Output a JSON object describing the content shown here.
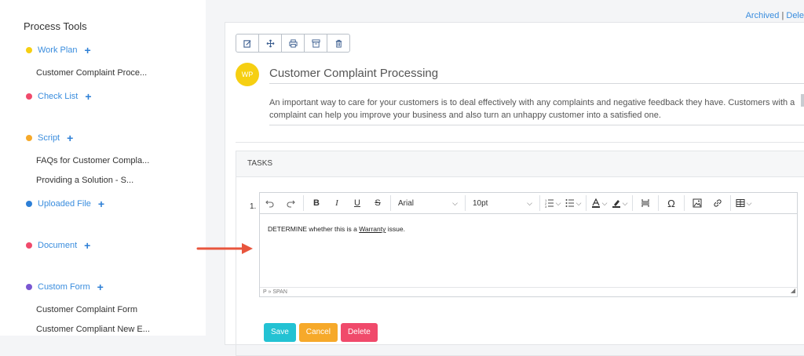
{
  "sidebar": {
    "title": "Process Tools",
    "sections": [
      {
        "label": "Work Plan",
        "color": "#f6cf12",
        "items": [
          "Customer Complaint Proce..."
        ]
      },
      {
        "label": "Check List",
        "color": "#f04a6b",
        "items": []
      },
      {
        "label": "Script",
        "color": "#f6a92a",
        "items": [
          "FAQs for Customer Compla...",
          "Providing a Solution - S..."
        ]
      },
      {
        "label": "Uploaded File",
        "color": "#2d7fd6",
        "items": []
      },
      {
        "label": "Document",
        "color": "#f04a6b",
        "items": []
      },
      {
        "label": "Custom Form",
        "color": "#7a57d1",
        "items": [
          "Customer Complaint Form",
          "Customer Compliant New E..."
        ]
      }
    ]
  },
  "top_links": {
    "archived": "Archived",
    "separator": "|",
    "delete": "Dele"
  },
  "card": {
    "avatar": "WP",
    "title": "Customer Complaint Processing",
    "description": "An important way to care for your customers is to deal effectively with any complaints and negative feedback they have. Customers with a complaint can help you improve your business and also turn an unhappy customer into a satisfied one."
  },
  "tasks": {
    "header": "TASKS",
    "number": "1.",
    "editor": {
      "font_family": "Arial",
      "font_size": "10pt",
      "content_prefix": "DETERMINE whether this is a ",
      "content_link": "Warranty",
      "content_suffix": " issue.",
      "statusbar": "P » SPAN"
    },
    "buttons": {
      "save": "Save",
      "cancel": "Cancel",
      "delete": "Delete"
    }
  },
  "icons": {
    "toolbar": [
      "edit-icon",
      "move-icon",
      "print-icon",
      "archive-icon",
      "trash-icon"
    ]
  }
}
